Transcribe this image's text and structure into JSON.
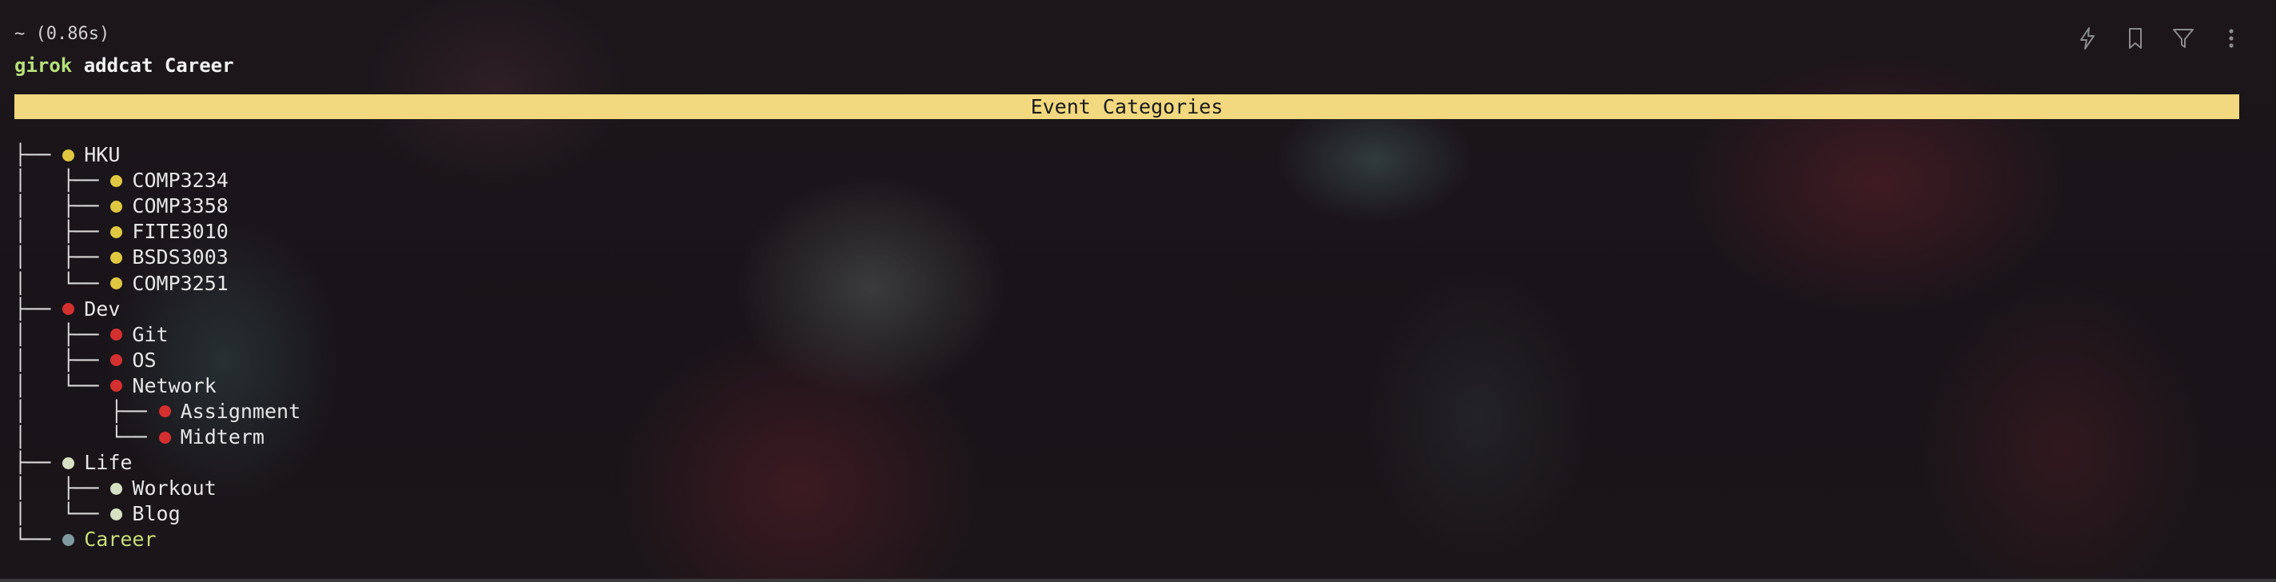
{
  "command": {
    "timing": "~ (0.86s)",
    "program": "girok",
    "args": "addcat Career"
  },
  "panel": {
    "title": "Event Categories"
  },
  "colors": {
    "hku": "#e0c742",
    "dev": "#d43030",
    "life": "#d6e0c2",
    "career": "#7f9aa0",
    "title_bar": "#f2d87e"
  },
  "tree": [
    {
      "guide": "├── ",
      "label": "HKU",
      "color_key": "hku"
    },
    {
      "guide": "│   ├── ",
      "label": "COMP3234",
      "color_key": "hku"
    },
    {
      "guide": "│   ├── ",
      "label": "COMP3358",
      "color_key": "hku"
    },
    {
      "guide": "│   ├── ",
      "label": "FITE3010",
      "color_key": "hku"
    },
    {
      "guide": "│   ├── ",
      "label": "BSDS3003",
      "color_key": "hku"
    },
    {
      "guide": "│   └── ",
      "label": "COMP3251",
      "color_key": "hku"
    },
    {
      "guide": "├── ",
      "label": "Dev",
      "color_key": "dev"
    },
    {
      "guide": "│   ├── ",
      "label": "Git",
      "color_key": "dev"
    },
    {
      "guide": "│   ├── ",
      "label": "OS",
      "color_key": "dev"
    },
    {
      "guide": "│   └── ",
      "label": "Network",
      "color_key": "dev"
    },
    {
      "guide": "│       ├── ",
      "label": "Assignment",
      "color_key": "dev"
    },
    {
      "guide": "│       └── ",
      "label": "Midterm",
      "color_key": "dev"
    },
    {
      "guide": "├── ",
      "label": "Life",
      "color_key": "life"
    },
    {
      "guide": "│   ├── ",
      "label": "Workout",
      "color_key": "life"
    },
    {
      "guide": "│   └── ",
      "label": "Blog",
      "color_key": "life"
    },
    {
      "guide": "└── ",
      "label": "Career",
      "color_key": "career",
      "highlight": true
    }
  ],
  "toolbar": {
    "icons": [
      "lightning-icon",
      "bookmark-icon",
      "filter-icon",
      "more-vertical-icon"
    ]
  }
}
